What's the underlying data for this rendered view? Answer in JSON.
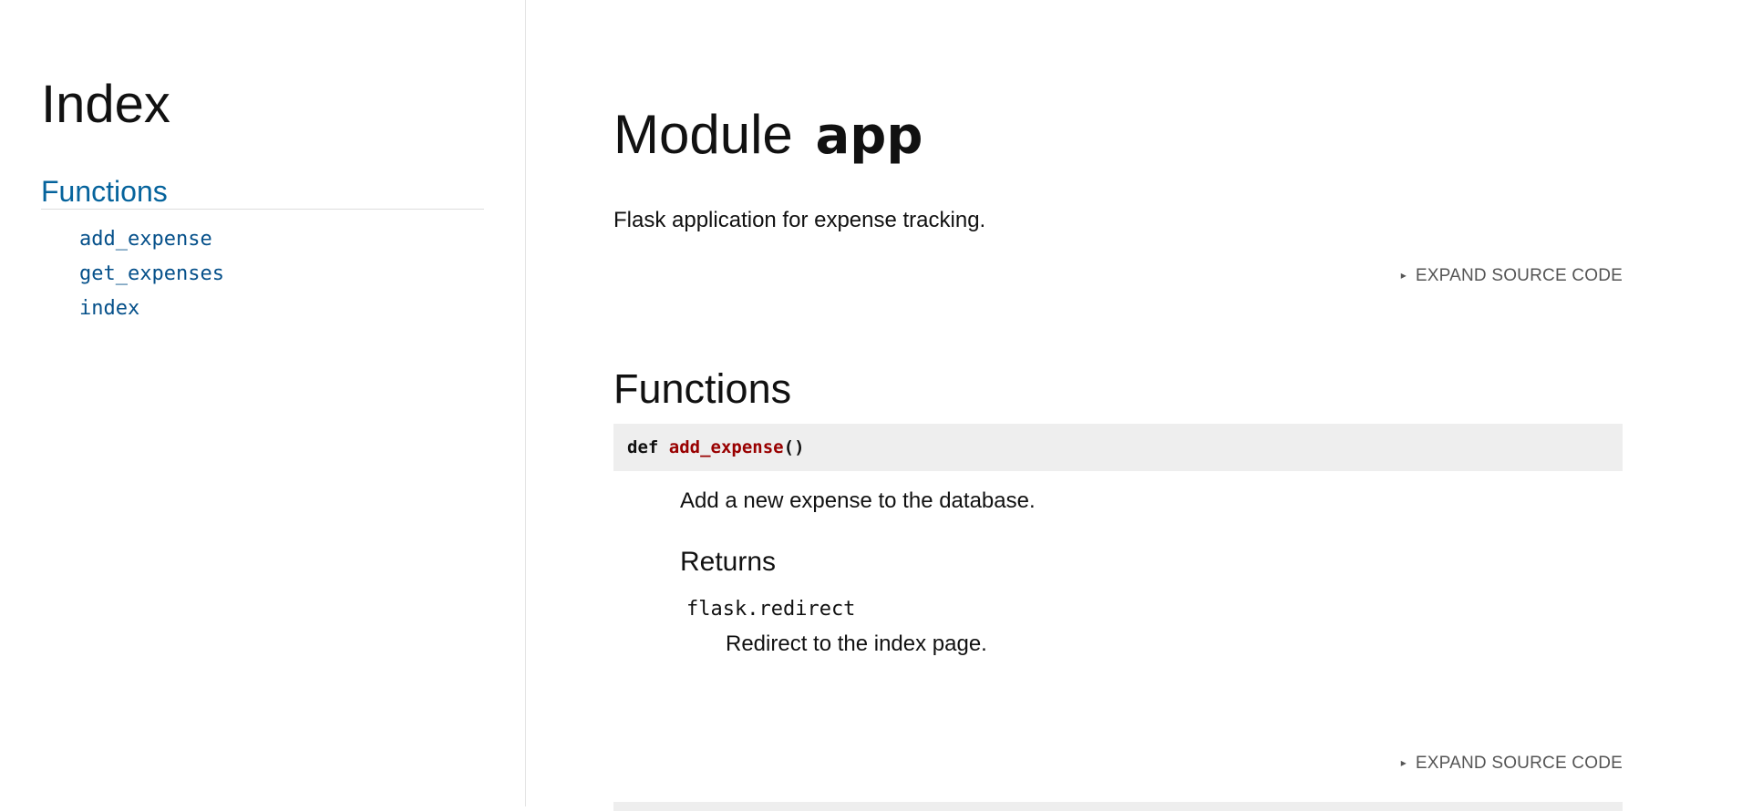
{
  "sidebar": {
    "title": "Index",
    "section_label": "Functions",
    "items": [
      {
        "label": "add_expense"
      },
      {
        "label": "get_expenses"
      },
      {
        "label": "index"
      }
    ]
  },
  "main": {
    "module_word": "Module",
    "module_name": "app",
    "description": "Flask application for expense tracking.",
    "expand_label": "EXPAND SOURCE CODE",
    "expand_icon": "▸",
    "functions_heading": "Functions",
    "functions": [
      {
        "keyword": "def",
        "name": "add_expense",
        "params": "()",
        "description": "Add a new expense to the database.",
        "returns_heading": "Returns",
        "return_type": "flask.redirect",
        "return_desc": "Redirect to the index page."
      }
    ]
  }
}
